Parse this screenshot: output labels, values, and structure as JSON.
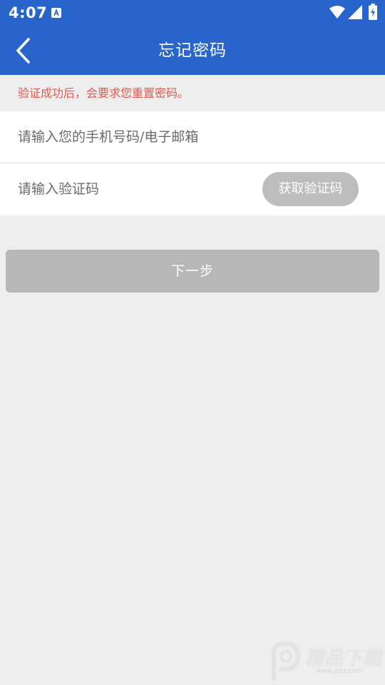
{
  "status_bar": {
    "time": "4:07",
    "icons": [
      "notification-a-icon",
      "wifi-icon",
      "cell-signal-icon",
      "battery-charging-icon"
    ]
  },
  "app_bar": {
    "back_icon": "chevron-left-icon",
    "title": "忘记密码"
  },
  "notice": {
    "text": "验证成功后，会要求您重置密码。",
    "color": "#e05a4e"
  },
  "form": {
    "account_field": {
      "value": "",
      "placeholder": "请输入您的手机号码/电子邮箱"
    },
    "code_field": {
      "value": "",
      "placeholder": "请输入验证码"
    },
    "get_code_label": "获取验证码"
  },
  "next_label": "下一步",
  "watermark": {
    "text": "精品下载",
    "url": "www.jpxz.com"
  },
  "colors": {
    "primary": "#2764cb",
    "background": "#eeeeee",
    "disabled_button": "#b7b7b7",
    "get_code_button": "#bdbdbd"
  }
}
